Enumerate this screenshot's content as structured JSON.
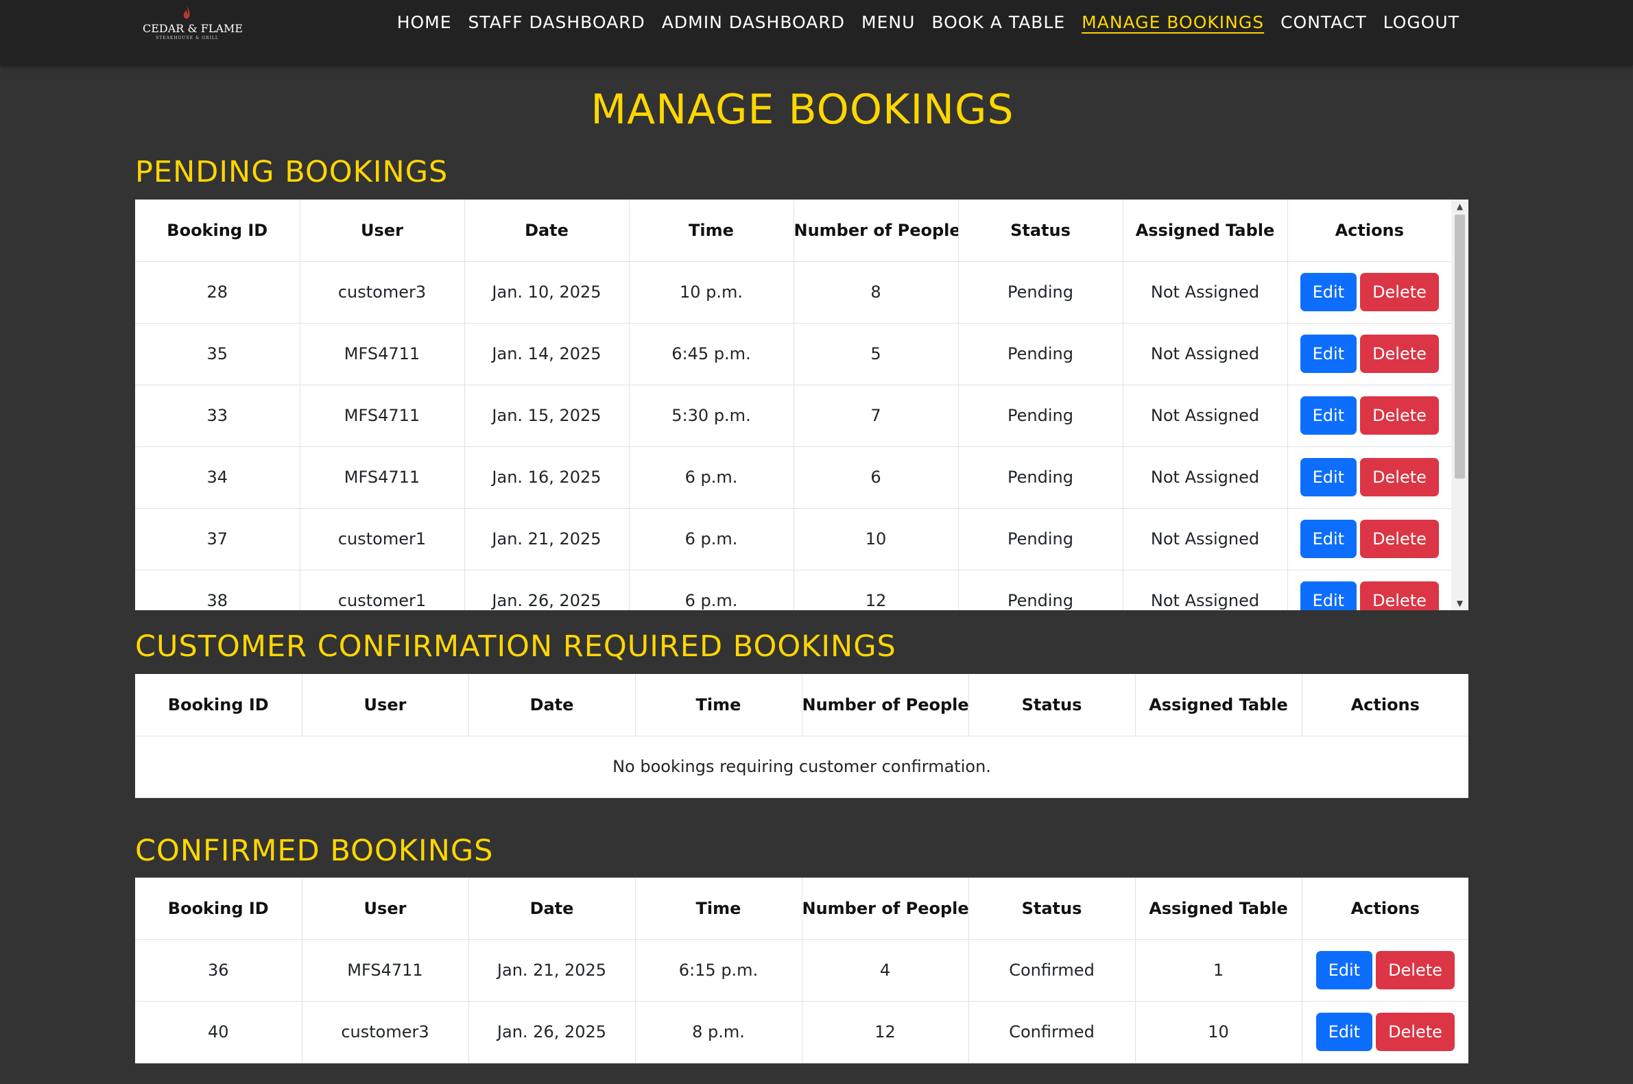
{
  "brand": {
    "name": "CEDAR & FLAME",
    "tagline": "STEAKHOUSE & GRILL"
  },
  "nav": [
    {
      "label": "HOME",
      "active": false
    },
    {
      "label": "STAFF DASHBOARD",
      "active": false
    },
    {
      "label": "ADMIN DASHBOARD",
      "active": false
    },
    {
      "label": "MENU",
      "active": false
    },
    {
      "label": "BOOK A TABLE",
      "active": false
    },
    {
      "label": "MANAGE BOOKINGS",
      "active": true
    },
    {
      "label": "CONTACT",
      "active": false
    },
    {
      "label": "LOGOUT",
      "active": false
    }
  ],
  "page_title": "MANAGE BOOKINGS",
  "columns": [
    "Booking ID",
    "User",
    "Date",
    "Time",
    "Number of People",
    "Status",
    "Assigned Table",
    "Actions"
  ],
  "buttons": {
    "edit": "Edit",
    "delete": "Delete"
  },
  "pending": {
    "title": "PENDING BOOKINGS",
    "rows": [
      {
        "id": "28",
        "user": "customer3",
        "date": "Jan. 10, 2025",
        "time": "10 p.m.",
        "people": "8",
        "status": "Pending",
        "table": "Not Assigned"
      },
      {
        "id": "35",
        "user": "MFS4711",
        "date": "Jan. 14, 2025",
        "time": "6:45 p.m.",
        "people": "5",
        "status": "Pending",
        "table": "Not Assigned"
      },
      {
        "id": "33",
        "user": "MFS4711",
        "date": "Jan. 15, 2025",
        "time": "5:30 p.m.",
        "people": "7",
        "status": "Pending",
        "table": "Not Assigned"
      },
      {
        "id": "34",
        "user": "MFS4711",
        "date": "Jan. 16, 2025",
        "time": "6 p.m.",
        "people": "6",
        "status": "Pending",
        "table": "Not Assigned"
      },
      {
        "id": "37",
        "user": "customer1",
        "date": "Jan. 21, 2025",
        "time": "6 p.m.",
        "people": "10",
        "status": "Pending",
        "table": "Not Assigned"
      },
      {
        "id": "38",
        "user": "customer1",
        "date": "Jan. 26, 2025",
        "time": "6 p.m.",
        "people": "12",
        "status": "Pending",
        "table": "Not Assigned"
      }
    ]
  },
  "confirmation_required": {
    "title": "CUSTOMER CONFIRMATION REQUIRED BOOKINGS",
    "empty_message": "No bookings requiring customer confirmation."
  },
  "confirmed": {
    "title": "CONFIRMED BOOKINGS",
    "rows": [
      {
        "id": "36",
        "user": "MFS4711",
        "date": "Jan. 21, 2025",
        "time": "6:15 p.m.",
        "people": "4",
        "status": "Confirmed",
        "table": "1"
      },
      {
        "id": "40",
        "user": "customer3",
        "date": "Jan. 26, 2025",
        "time": "8 p.m.",
        "people": "12",
        "status": "Confirmed",
        "table": "10"
      }
    ]
  },
  "colors": {
    "accent": "#ffd700",
    "background": "#333333",
    "navbar": "#222222",
    "edit": "#0d6efd",
    "delete": "#dc3545"
  }
}
